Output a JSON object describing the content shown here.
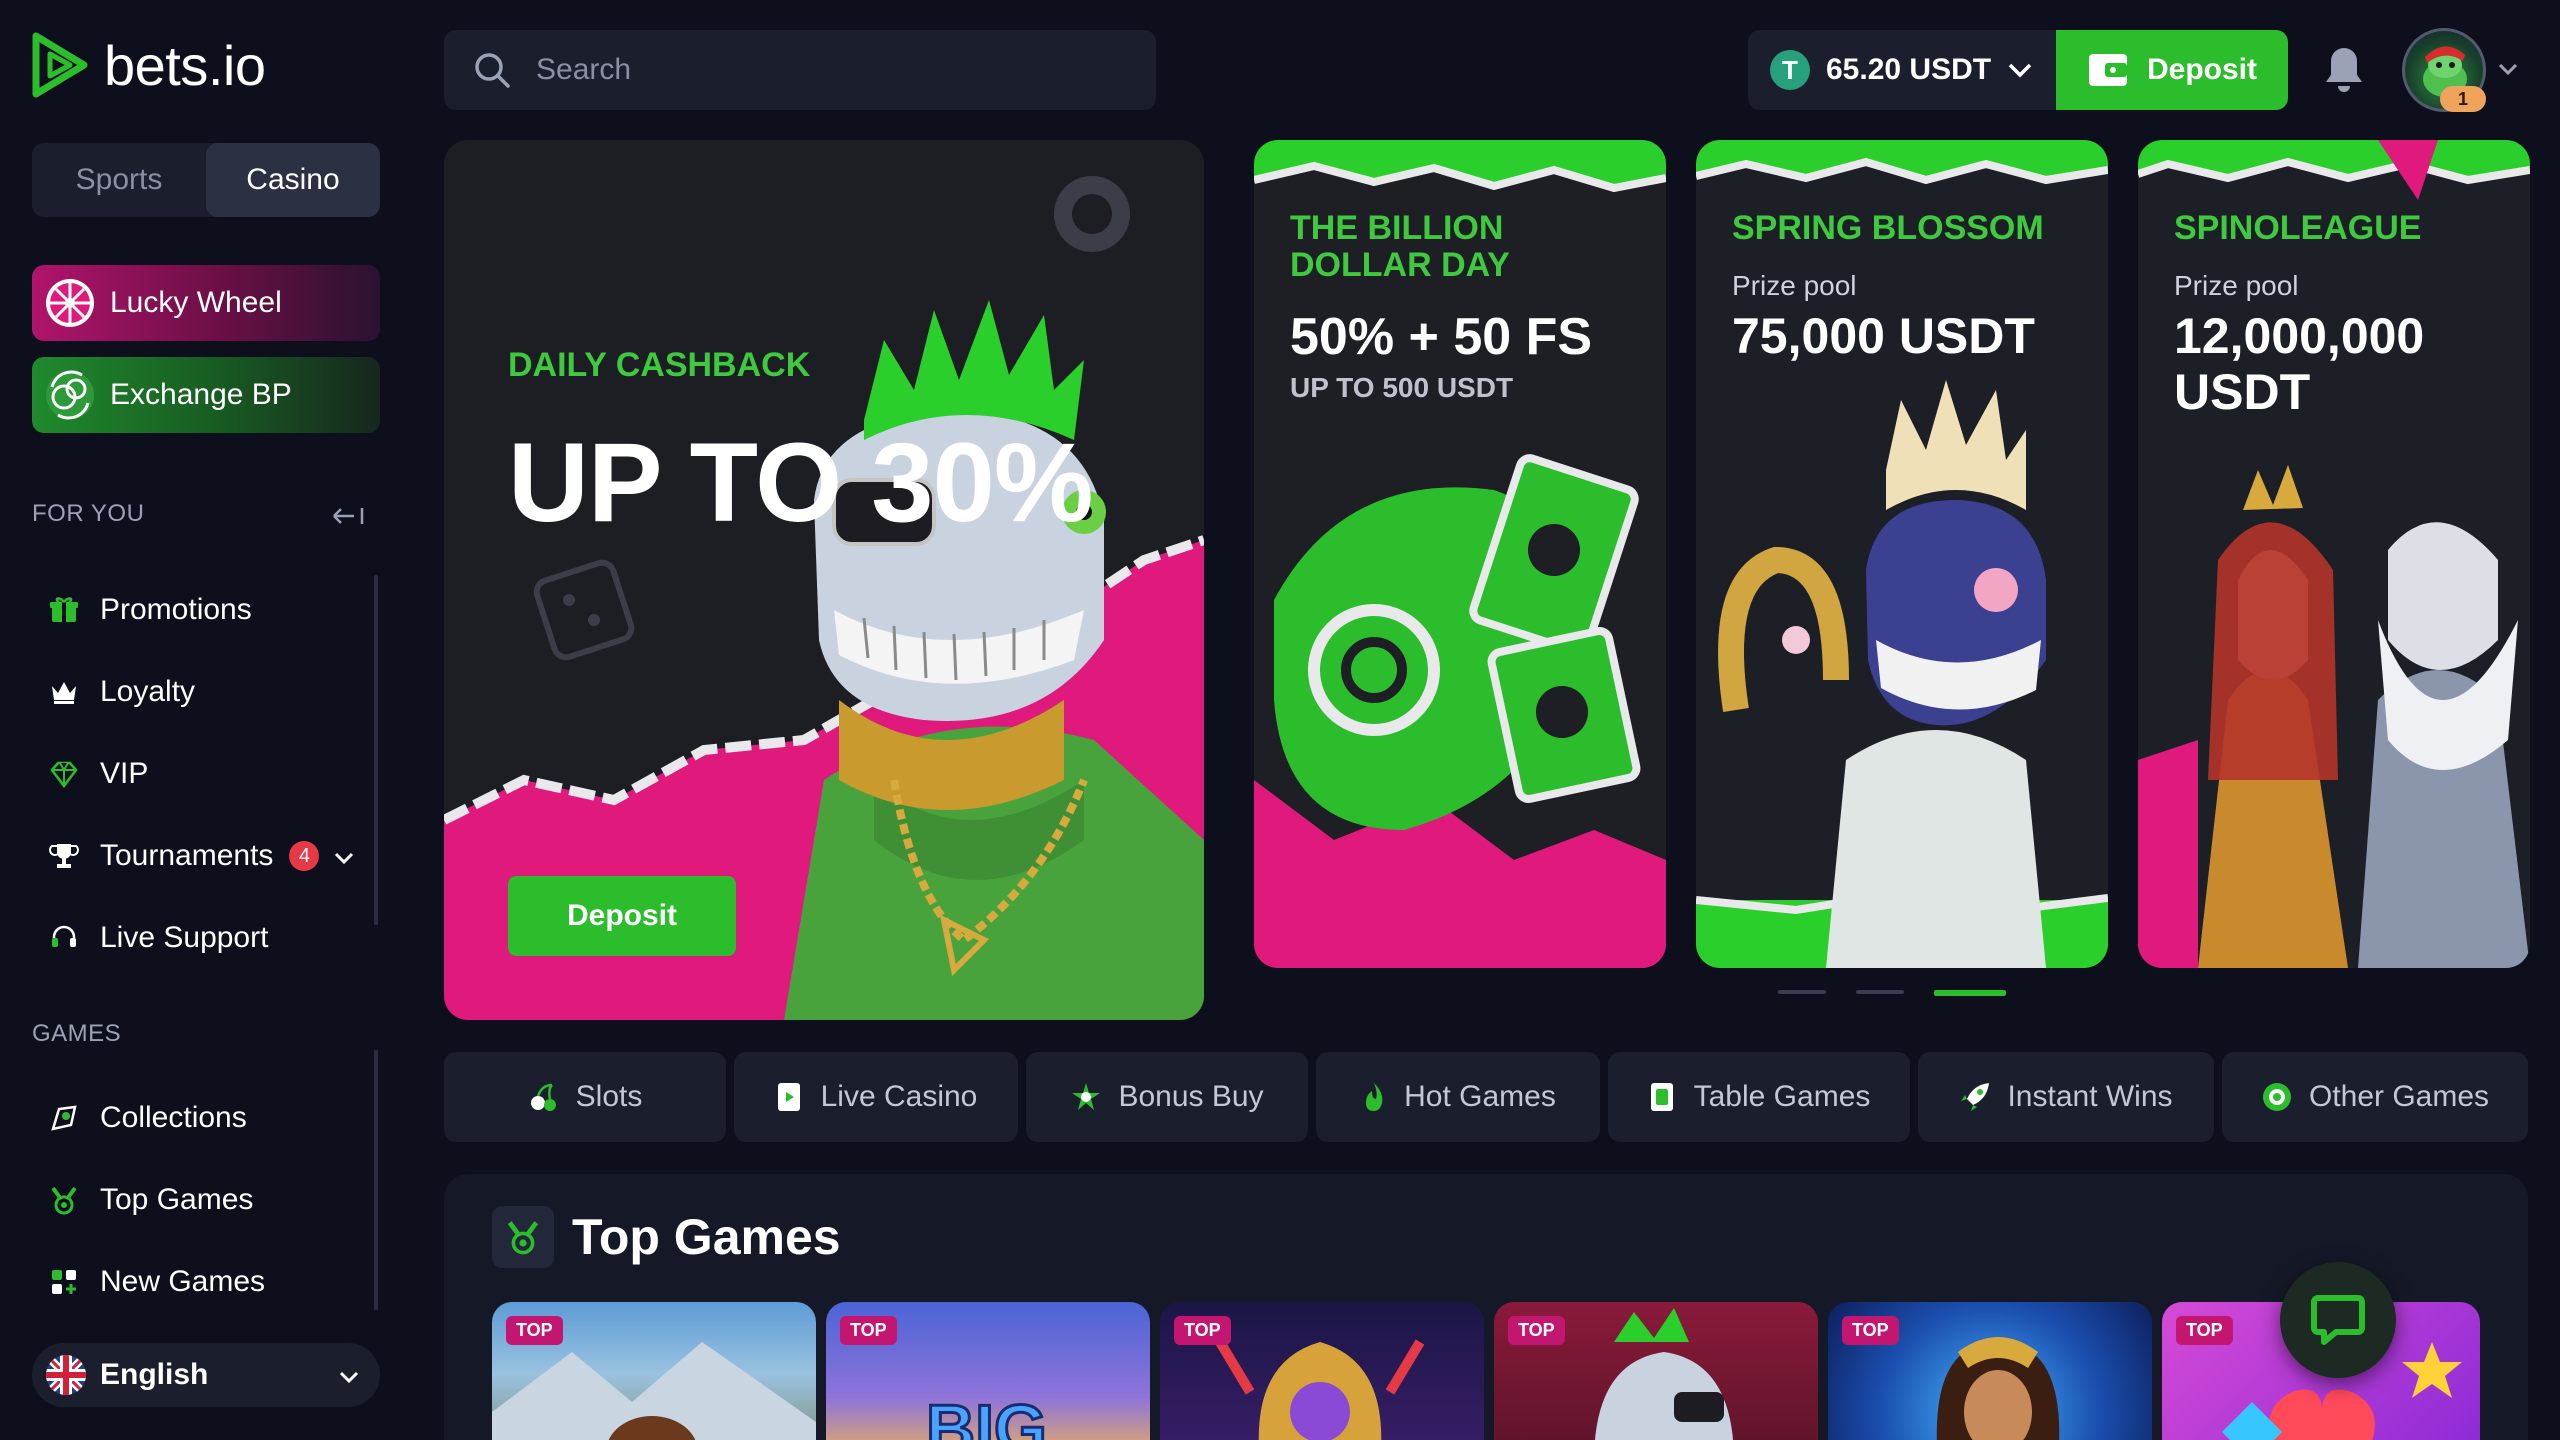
{
  "brand": {
    "name": "bets.io"
  },
  "mode_switch": {
    "sports": "Sports",
    "casino": "Casino",
    "active": "casino"
  },
  "promos": {
    "lucky_wheel": "Lucky Wheel",
    "exchange": "Exchange BP"
  },
  "sections": {
    "for_you": "FOR YOU",
    "games": "GAMES"
  },
  "for_you_items": [
    {
      "label": "Promotions",
      "icon": "gift-icon"
    },
    {
      "label": "Loyalty",
      "icon": "crown-icon"
    },
    {
      "label": "VIP",
      "icon": "diamond-icon"
    },
    {
      "label": "Tournaments",
      "icon": "trophy-icon",
      "badge": "4"
    },
    {
      "label": "Live Support",
      "icon": "headset-icon"
    }
  ],
  "games_items": [
    {
      "label": "Collections",
      "icon": "collections-icon"
    },
    {
      "label": "Top Games",
      "icon": "medal-icon"
    },
    {
      "label": "New Games",
      "icon": "new-games-icon"
    }
  ],
  "language": {
    "label": "English"
  },
  "search": {
    "placeholder": "Search"
  },
  "wallet": {
    "balance": "65.20 USDT",
    "currency_symbol": "T",
    "deposit_label": "Deposit"
  },
  "user": {
    "notification_count": "1"
  },
  "hero": {
    "kicker": "DAILY CASHBACK",
    "title": "UP TO 30%",
    "cta": "Deposit"
  },
  "promo_cards": [
    {
      "kicker": "THE BILLION DOLLAR DAY",
      "big": "50% + 50 FS",
      "sub": "UP TO 500 USDT"
    },
    {
      "kicker": "SPRING BLOSSOM",
      "sub": "Prize pool",
      "big": "75,000 USDT"
    },
    {
      "kicker": "SPINOLEAGUE",
      "sub": "Prize pool",
      "big": "12,000,000 USDT"
    }
  ],
  "carousel": {
    "pages": 3,
    "active_index": 2
  },
  "categories": [
    {
      "label": "Slots",
      "icon": "cherries-icon"
    },
    {
      "label": "Live Casino",
      "icon": "live-card-icon"
    },
    {
      "label": "Bonus Buy",
      "icon": "bonus-icon"
    },
    {
      "label": "Hot Games",
      "icon": "flame-icon"
    },
    {
      "label": "Table Games",
      "icon": "table-card-icon"
    },
    {
      "label": "Instant Wins",
      "icon": "rocket-icon"
    },
    {
      "label": "Other Games",
      "icon": "chip-icon"
    }
  ],
  "top_games": {
    "title": "Top Games",
    "tag": "TOP",
    "tiles": [
      "TOP",
      "TOP",
      "TOP",
      "TOP",
      "TOP",
      "TOP"
    ],
    "tile_texts": [
      "",
      "BIG",
      "",
      "",
      "",
      ""
    ]
  },
  "colors": {
    "accent": "#2bbd2b",
    "pink": "#e0197d",
    "bg": "#0d0f1c",
    "panel": "#1b1e2d"
  }
}
